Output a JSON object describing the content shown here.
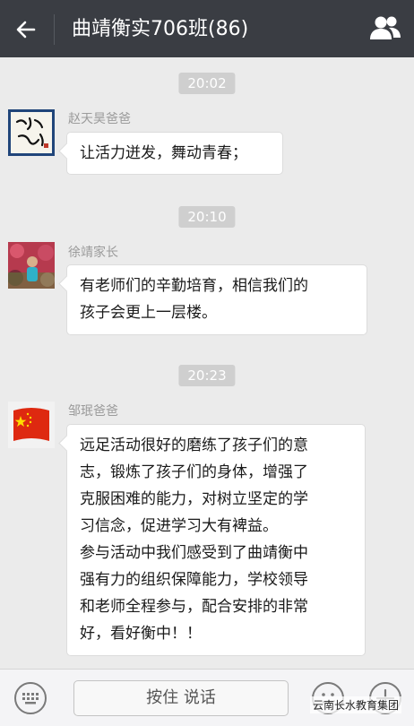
{
  "header": {
    "title": "曲靖衡实706班(86)",
    "back_icon": "back-arrow-icon",
    "contacts_icon": "group-members-icon"
  },
  "messages": [
    {
      "time": "20:02",
      "sender": "赵天昊爸爸",
      "lines": [
        "让活力迸发，舞动青春；"
      ]
    },
    {
      "time": "20:10",
      "sender": "徐靖家长",
      "lines": [
        "有老师们的辛勤培育，相信我们的",
        "孩子会更上一层楼。"
      ]
    },
    {
      "time": "20:23",
      "sender": "邹珉爸爸",
      "lines": [
        "远足活动很好的磨练了孩子们的意",
        "志，锻炼了孩子们的身体，增强了",
        "克服困难的能力，对树立坚定的学",
        "习信念，促进学习大有裨益。",
        "参与活动中我们感受到了曲靖衡中",
        "强有力的组织保障能力，学校领导",
        "和老师全程参与，配合安排的非常",
        "好，看好衡中！！"
      ]
    }
  ],
  "input_bar": {
    "hold_to_talk": "按住 说话",
    "keyboard_icon": "keyboard-icon",
    "emoji_icon": "emoji-icon",
    "plus_icon": "plus-icon",
    "watermark": "云南长水教育集团"
  }
}
